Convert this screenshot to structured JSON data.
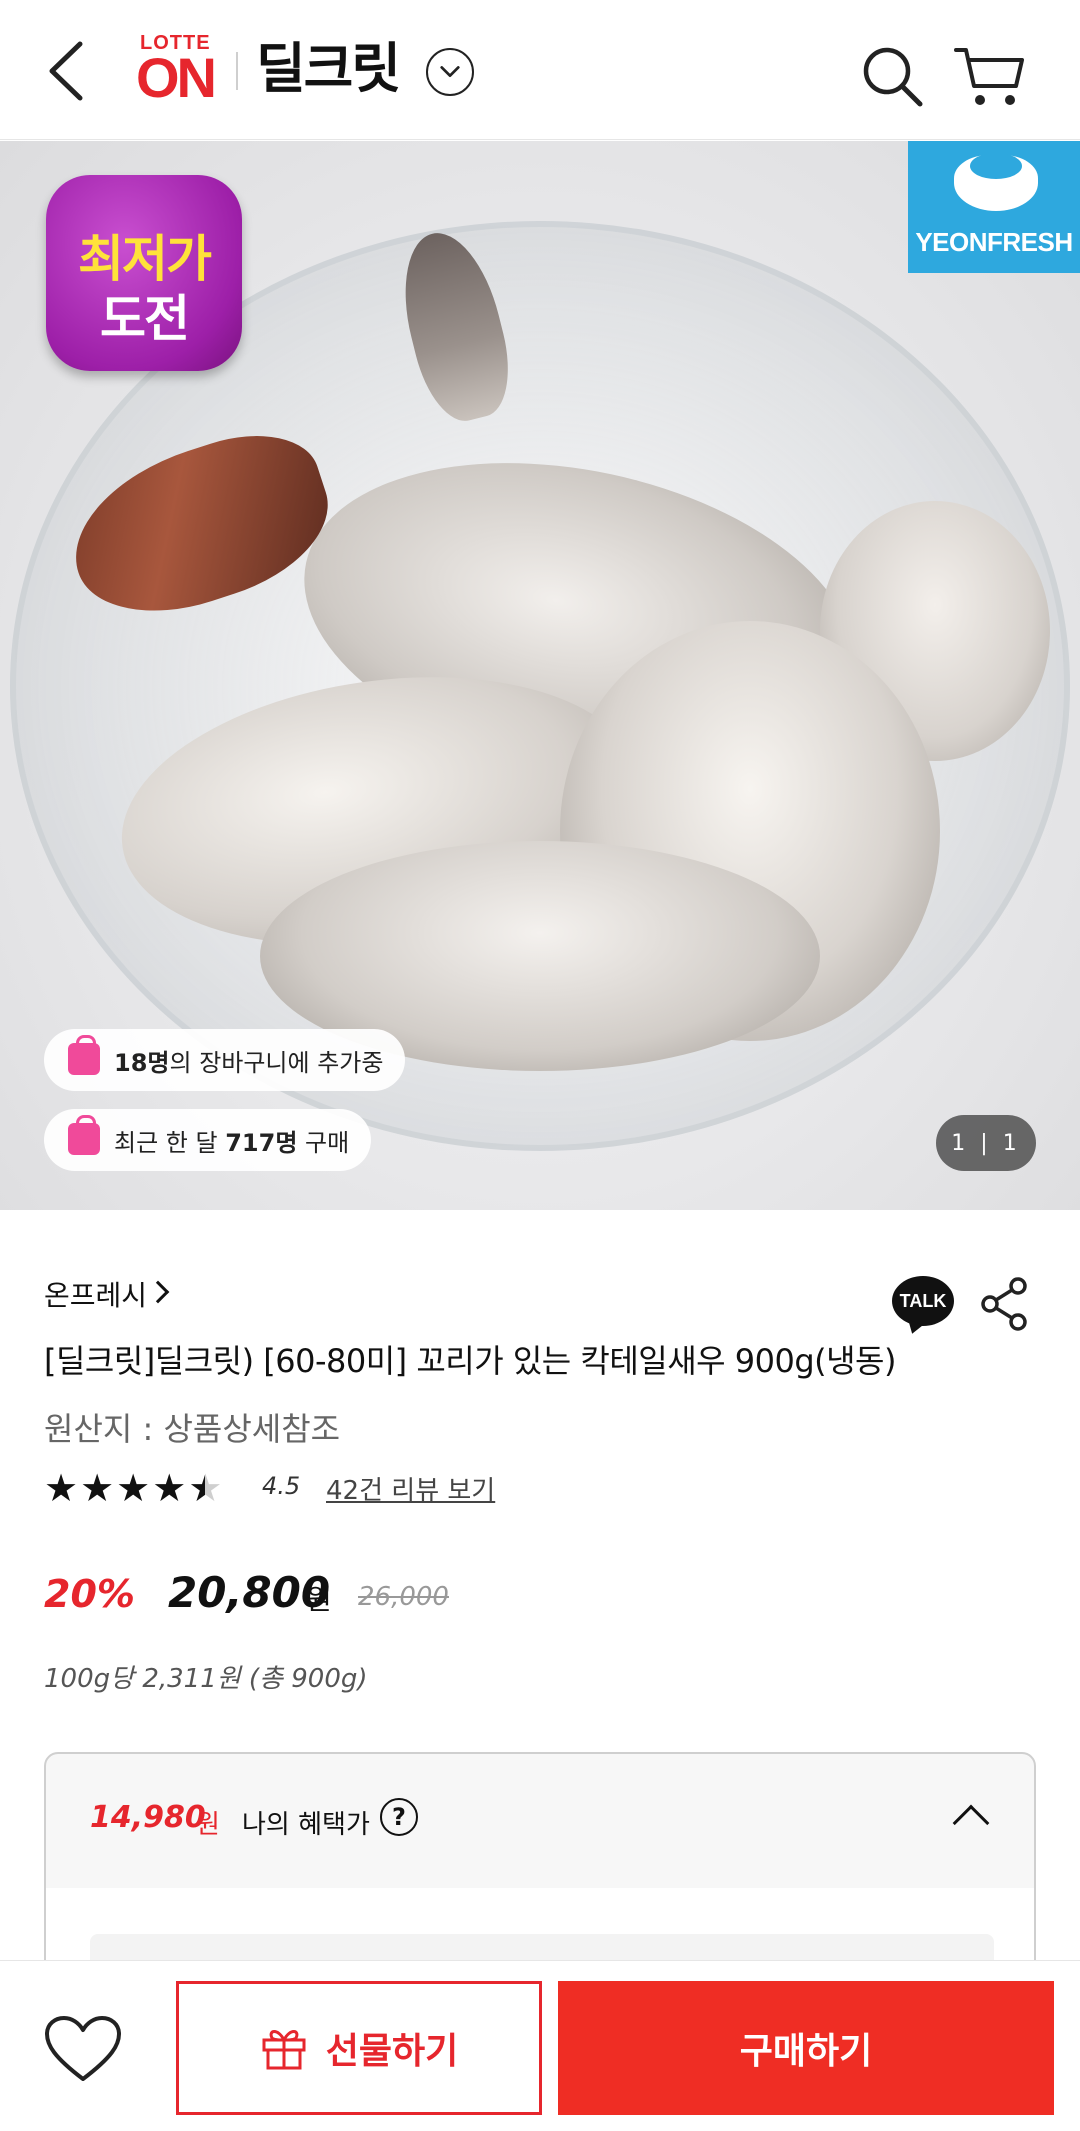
{
  "header": {
    "logo_top": "LOTTE",
    "logo_main": "ON",
    "store_name": "딜크릿"
  },
  "hero": {
    "badge_line1": "최저가",
    "badge_line2": "도전",
    "brand_logo_text": "YEONFRESH",
    "cart_count": "18명",
    "cart_text": "의 장바구니에 추가중",
    "recent_prefix": "최근 한 달 ",
    "recent_count": "717명",
    "recent_suffix": " 구매",
    "image_counter": "1 | 1"
  },
  "product": {
    "seller": "온프레시",
    "talk_label": "TALK",
    "title": "[딜크릿]딜크릿) [60-80미] 꼬리가 있는 칵테일새우 900g(냉동)",
    "origin": "원산지 : 상품상세참조",
    "rating": 4.5,
    "rating_text": "4.5",
    "review_link": "42건 리뷰 보기",
    "discount": "20%",
    "price": "20,800",
    "price_unit": "원",
    "original_price": "26,000",
    "unit_price": "100g당 2,311원 (총 900g)"
  },
  "benefit": {
    "price": "14,980",
    "price_unit": "원",
    "label": "나의 혜택가",
    "help": "?"
  },
  "bottom_bar": {
    "gift_label": "선물하기",
    "buy_label": "구매하기"
  },
  "colors": {
    "brand_red": "#e6262d",
    "buy_button": "#ef2d24",
    "badge_purple": "#9d1fa8",
    "brand_blue": "#2ea8de"
  }
}
